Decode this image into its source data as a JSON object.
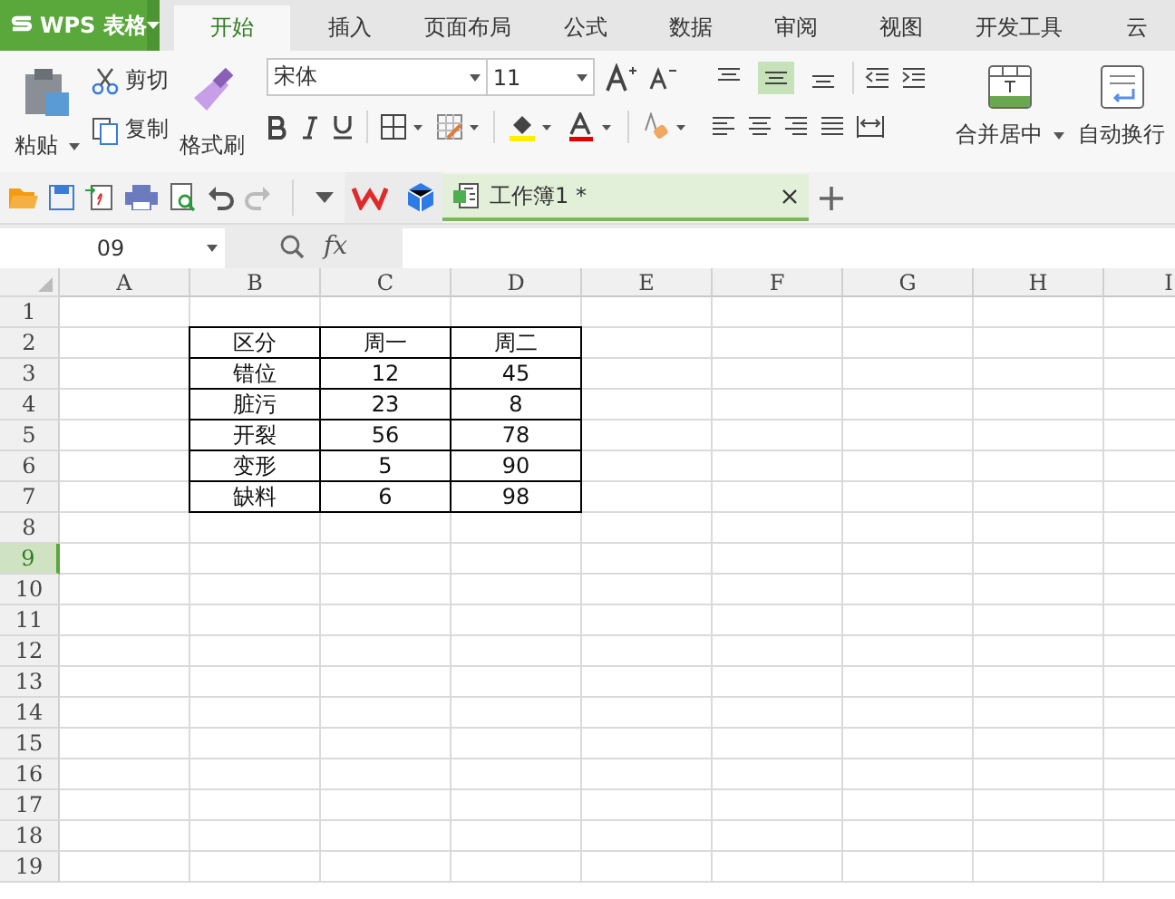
{
  "app": {
    "title": "WPS 表格"
  },
  "tabs": [
    {
      "label": "开始",
      "selected": true
    },
    {
      "label": "插入",
      "selected": false
    },
    {
      "label": "页面布局",
      "selected": false
    },
    {
      "label": "公式",
      "selected": false
    },
    {
      "label": "数据",
      "selected": false
    },
    {
      "label": "审阅",
      "selected": false
    },
    {
      "label": "视图",
      "selected": false
    },
    {
      "label": "开发工具",
      "selected": false
    },
    {
      "label": "云",
      "selected": false
    }
  ],
  "ribbon": {
    "paste": "粘贴",
    "cut": "剪切",
    "copy": "复制",
    "format_painter": "格式刷",
    "font_name": "宋体",
    "font_size": "11",
    "align_buttons": [
      {
        "kind": "top",
        "selected": false
      },
      {
        "kind": "middle",
        "selected": true
      },
      {
        "kind": "bottom",
        "selected": false
      }
    ],
    "merge_center": "合并居中",
    "wrap_text": "自动换行"
  },
  "document_tab": {
    "title": "工作簿1 *"
  },
  "formula_bar": {
    "name_box": "09",
    "function_label": "fx"
  },
  "sheet": {
    "columns": [
      "A",
      "B",
      "C",
      "D",
      "E",
      "F",
      "G",
      "H",
      "I"
    ],
    "rows": [
      {
        "label": "1",
        "selected": false
      },
      {
        "label": "2",
        "selected": false,
        "cells": {
          "B": "区分",
          "C": "周一",
          "D": "周二"
        }
      },
      {
        "label": "3",
        "selected": false,
        "cells": {
          "B": "错位",
          "C": "12",
          "D": "45"
        }
      },
      {
        "label": "4",
        "selected": false,
        "cells": {
          "B": "脏污",
          "C": "23",
          "D": "8"
        }
      },
      {
        "label": "5",
        "selected": false,
        "cells": {
          "B": "开裂",
          "C": "56",
          "D": "78"
        }
      },
      {
        "label": "6",
        "selected": false,
        "cells": {
          "B": "变形",
          "C": "5",
          "D": "90"
        }
      },
      {
        "label": "7",
        "selected": false,
        "cells": {
          "B": "缺料",
          "C": "6",
          "D": "98"
        }
      },
      {
        "label": "8",
        "selected": false
      },
      {
        "label": "9",
        "selected": true
      },
      {
        "label": "10",
        "selected": false
      },
      {
        "label": "11",
        "selected": false
      },
      {
        "label": "12",
        "selected": false
      },
      {
        "label": "13",
        "selected": false
      },
      {
        "label": "14",
        "selected": false
      },
      {
        "label": "15",
        "selected": false
      },
      {
        "label": "16",
        "selected": false
      },
      {
        "label": "17",
        "selected": false
      },
      {
        "label": "18",
        "selected": false
      },
      {
        "label": "19",
        "selected": false
      }
    ]
  }
}
